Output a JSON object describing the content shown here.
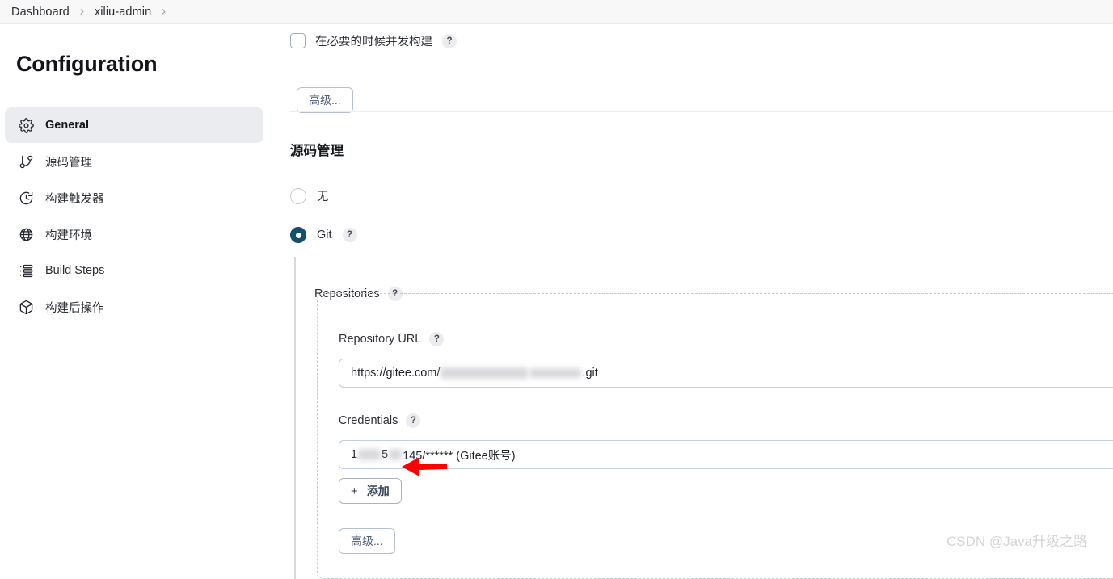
{
  "breadcrumb": {
    "items": [
      {
        "label": "Dashboard"
      },
      {
        "label": "xiliu-admin"
      }
    ],
    "separator_icon": "chevron-right-icon"
  },
  "sidebar": {
    "title": "Configuration",
    "items": [
      {
        "label": "General",
        "icon": "gear-icon",
        "active": true
      },
      {
        "label": "源码管理",
        "icon": "git-branch-icon",
        "active": false
      },
      {
        "label": "构建触发器",
        "icon": "clock-icon",
        "active": false
      },
      {
        "label": "构建环境",
        "icon": "globe-icon",
        "active": false
      },
      {
        "label": "Build Steps",
        "icon": "list-steps-icon",
        "active": false
      },
      {
        "label": "构建后操作",
        "icon": "package-icon",
        "active": false
      }
    ]
  },
  "content": {
    "concurrent_build": {
      "label": "在必要的时候并发构建",
      "checked": false,
      "help_label": "?"
    },
    "advanced_top_label": "高级...",
    "scm": {
      "heading": "源码管理",
      "options": [
        {
          "label": "无",
          "selected": false
        },
        {
          "label": "Git",
          "selected": true,
          "help_label": "?"
        }
      ],
      "repositories": {
        "label": "Repositories",
        "help_label": "?",
        "repository_url": {
          "label": "Repository URL",
          "help_label": "?",
          "value_prefix": "https://gitee.com/",
          "value_suffix": ".git",
          "redacted": true
        },
        "credentials": {
          "label": "Credentials",
          "help_label": "?",
          "value_prefix": "1",
          "value_mid": "5",
          "value_suffix": "145/****** (Gitee账号)",
          "redacted": true
        },
        "add_button": {
          "plus": "+",
          "label": "添加"
        },
        "advanced_label": "高级..."
      }
    }
  },
  "annotation": {
    "arrow_color": "#ff0000",
    "arrow_direction": "left"
  },
  "watermark": {
    "text": "CSDN @Java升级之路"
  },
  "colors": {
    "accent_selected": "#14506e",
    "bar_background": "#f8f8f8",
    "active_nav_background": "#ebecef",
    "button_border": "#b6bfcc",
    "button_text": "#4d5a7a"
  }
}
